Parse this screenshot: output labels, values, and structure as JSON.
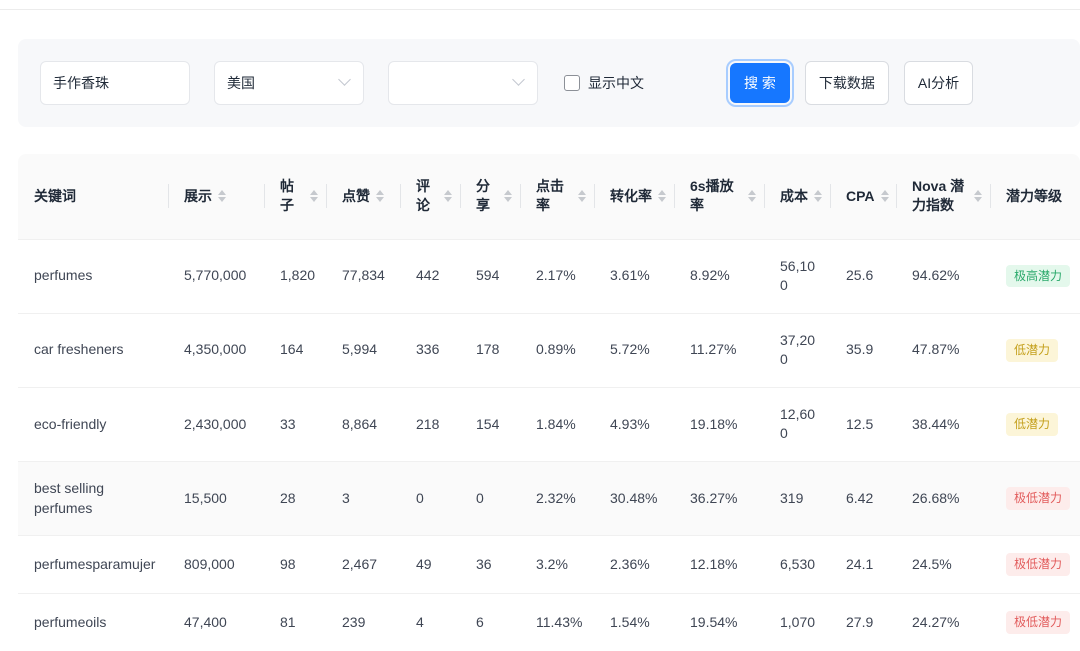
{
  "filters": {
    "keyword_input": "手作香珠",
    "country_select": "美国",
    "category_select": "",
    "show_chinese_label": "显示中文",
    "show_chinese_checked": false,
    "search_button": "搜 索",
    "download_button": "下载数据",
    "ai_button": "AI分析"
  },
  "table": {
    "columns": [
      {
        "label": "关键词",
        "sortable": false
      },
      {
        "label": "展示",
        "sortable": true
      },
      {
        "label": "帖子",
        "sortable": true
      },
      {
        "label": "点赞",
        "sortable": true
      },
      {
        "label": "评论",
        "sortable": true
      },
      {
        "label": "分享",
        "sortable": true
      },
      {
        "label": "点击率",
        "sortable": true
      },
      {
        "label": "转化率",
        "sortable": true
      },
      {
        "label": "6s播放率",
        "sortable": true
      },
      {
        "label": "成本",
        "sortable": true
      },
      {
        "label": "CPA",
        "sortable": true
      },
      {
        "label": "Nova 潜力指数",
        "sortable": true
      },
      {
        "label": "潜力等级",
        "sortable": false
      }
    ],
    "rows": [
      {
        "keyword": "perfumes",
        "values": [
          "5,770,000",
          "1,820",
          "77,834",
          "442",
          "594",
          "2.17%",
          "3.61%",
          "8.92%",
          "56,100",
          "25.6",
          "94.62%"
        ],
        "badge": "极高潜力",
        "badge_class": "badge badge-green"
      },
      {
        "keyword": "car fresheners",
        "values": [
          "4,350,000",
          "164",
          "5,994",
          "336",
          "178",
          "0.89%",
          "5.72%",
          "11.27%",
          "37,200",
          "35.9",
          "47.87%"
        ],
        "badge": "低潜力",
        "badge_class": "badge badge-yellow"
      },
      {
        "keyword": "eco-friendly",
        "values": [
          "2,430,000",
          "33",
          "8,864",
          "218",
          "154",
          "1.84%",
          "4.93%",
          "19.18%",
          "12,600",
          "12.5",
          "38.44%"
        ],
        "badge": "低潜力",
        "badge_class": "badge badge-yellow"
      },
      {
        "keyword": "best selling perfumes",
        "values": [
          "15,500",
          "28",
          "3",
          "0",
          "0",
          "2.32%",
          "30.48%",
          "36.27%",
          "319",
          "6.42",
          "26.68%"
        ],
        "badge": "极低潜力",
        "badge_class": "badge badge-red"
      },
      {
        "keyword": "perfumesparamujer",
        "values": [
          "809,000",
          "98",
          "2,467",
          "49",
          "36",
          "3.2%",
          "2.36%",
          "12.18%",
          "6,530",
          "24.1",
          "24.5%"
        ],
        "badge": "极低潜力",
        "badge_class": "badge badge-red"
      },
      {
        "keyword": "perfumeoils",
        "values": [
          "47,400",
          "81",
          "239",
          "4",
          "6",
          "11.43%",
          "1.54%",
          "19.54%",
          "1,070",
          "27.9",
          "24.27%"
        ],
        "badge": "极低潜力",
        "badge_class": "badge badge-red"
      }
    ]
  },
  "colors": {
    "primary_blue": "#1677ff",
    "panel_bg": "#f7f8fa",
    "header_bg": "#fafafa",
    "badge_green_bg": "#e4f8ec",
    "badge_green_text": "#2aa96b",
    "badge_yellow_bg": "#fcf5d8",
    "badge_yellow_text": "#c4a01c",
    "badge_red_bg": "#fdeceb",
    "badge_red_text": "#e25c5c"
  }
}
